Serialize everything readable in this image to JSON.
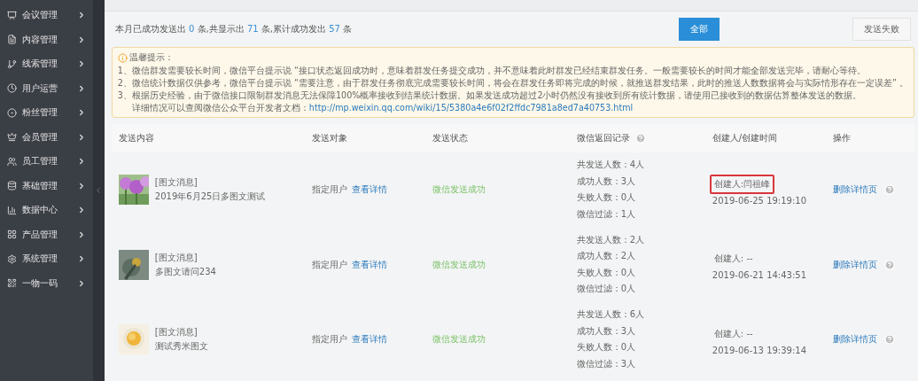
{
  "sidebar": {
    "items": [
      {
        "label": "会议管理"
      },
      {
        "label": "内容管理"
      },
      {
        "label": "线索管理"
      },
      {
        "label": "用户运营"
      },
      {
        "label": "粉丝管理"
      },
      {
        "label": "会员管理"
      },
      {
        "label": "员工管理"
      },
      {
        "label": "基础管理"
      },
      {
        "label": "数据中心"
      },
      {
        "label": "产品管理"
      },
      {
        "label": "系统管理"
      },
      {
        "label": "一物一码"
      }
    ]
  },
  "summary": [
    {
      "kind": "text",
      "text": "本月已成功发送出"
    },
    {
      "kind": "number",
      "text": "0"
    },
    {
      "kind": "text",
      "text": "条,共显示出"
    },
    {
      "kind": "number",
      "text": "71"
    },
    {
      "kind": "text",
      "text": "条,累计成功发出"
    },
    {
      "kind": "number",
      "text": "57"
    },
    {
      "kind": "text",
      "text": "条"
    }
  ],
  "filters": [
    {
      "label": "全部",
      "selected": true
    },
    {
      "label": "发送失败",
      "selected": false
    }
  ],
  "notice": {
    "title": "温馨提示：",
    "lines": [
      "1、微信群发需要较长时间，微信平台提示说 “接口状态返回成功时，意味着群发任务提交成功，并不意味着此时群发已经结束群发任务。一般需要较长的时间才能全部发送完毕，请耐心等待。",
      "2、微信统计数据仅供参考，微信平台提示说 “需要注意，由于群发任务彻底完成需要较长时间，将会在群发任务即将完成的时候，就推送群发结果，此时的推送人数数据将会与实际情形存在一定误差” 。",
      "3、根据历史经验，由于微信接口限制群发消息无法保障100%概率接收到结果统计数据。如果发送成功超过2小时仍然没有接收到所有统计数据，请使用已接收到的数据估算整体发送的数据。"
    ],
    "doc_label": "详细情况可以查阅微信公众平台开发者文档：",
    "doc_link": "http://mp.weixin.qq.com/wiki/15/5380a4e6f02f2ffdc7981a8ed7a40753.html"
  },
  "table": {
    "columns": [
      {
        "label": "发送内容",
        "help": false
      },
      {
        "label": "发送对象",
        "help": false
      },
      {
        "label": "发送状态",
        "help": false
      },
      {
        "label": "微信返回记录",
        "help": true
      },
      {
        "label": "创建人/创建时间",
        "help": false
      },
      {
        "label": "操作",
        "help": false
      }
    ],
    "rows": [
      {
        "type": "[图文消息]",
        "title": "2019年6月25日多图文测试",
        "target": "指定用户",
        "detail_link": "查看详情",
        "status": "微信发送成功",
        "records": [
          "共发送人数：4人",
          "成功人数：3人",
          "失败人数：0人",
          "微信过滤：1人"
        ],
        "creator": "创建人:闫祖峰",
        "highlighted": true,
        "time": "2019-06-25 19:19:10",
        "action": "删除详情页"
      },
      {
        "type": "[图文消息]",
        "title": "多图文请问234",
        "target": "指定用户",
        "detail_link": "查看详情",
        "status": "微信发送成功",
        "records": [
          "共发送人数：2人",
          "成功人数：2人",
          "失败人数：0人",
          "微信过滤：0人"
        ],
        "creator": "创建人: --",
        "highlighted": false,
        "time": "2019-06-21 14:43:51",
        "action": "删除详情页"
      },
      {
        "type": "[图文消息]",
        "title": "测试秀米图文",
        "target": "指定用户",
        "detail_link": "查看详情",
        "status": "微信发送成功",
        "records": [
          "共发送人数：6人",
          "成功人数：3人",
          "失败人数：0人",
          "微信过滤：3人"
        ],
        "creator": "创建人: --",
        "highlighted": false,
        "time": "2019-06-13 19:39:14",
        "action": "删除详情页"
      }
    ]
  }
}
